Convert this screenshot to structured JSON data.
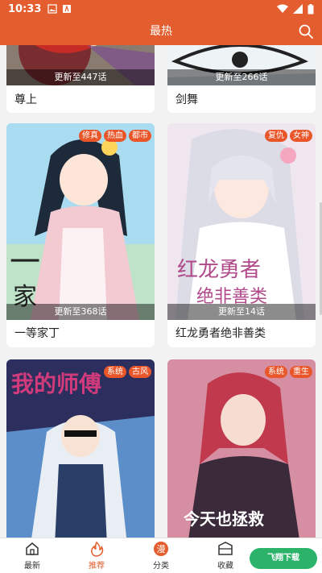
{
  "status_bar": {
    "time": "10:33"
  },
  "app_bar": {
    "title": "最热"
  },
  "comics": [
    {
      "title": "尊上",
      "update": "更新至447话",
      "tags": []
    },
    {
      "title": "剑舞",
      "update": "更新至266话",
      "tags": []
    },
    {
      "title": "一等家丁",
      "update": "更新至368话",
      "tags": [
        "修真",
        "热血",
        "都市"
      ]
    },
    {
      "title": "红龙勇者绝非善类",
      "update": "更新至14话",
      "tags": [
        "复仇",
        "女神"
      ]
    },
    {
      "title": "",
      "update": "",
      "tags": [
        "系统",
        "古风"
      ]
    },
    {
      "title": "",
      "update": "",
      "tags": [
        "系统",
        "重生"
      ]
    }
  ],
  "bottom_nav": [
    {
      "label": "最新",
      "icon": "home-icon"
    },
    {
      "label": "推荐",
      "icon": "flame-icon"
    },
    {
      "label": "分类",
      "icon": "manga-icon"
    },
    {
      "label": "收藏",
      "icon": "shelf-icon"
    },
    {
      "label": "",
      "icon": "profile-icon"
    }
  ],
  "colors": {
    "accent": "#e45d2e",
    "tag": "#e8562a"
  }
}
